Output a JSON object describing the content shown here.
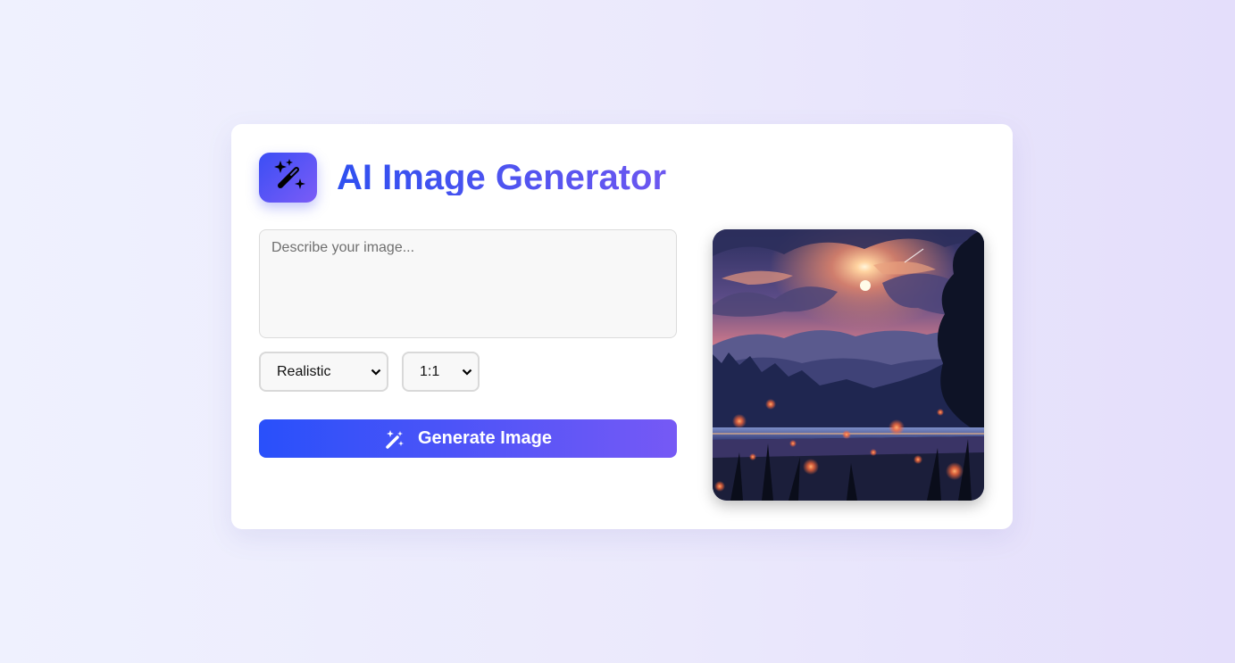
{
  "app": {
    "title": "AI Image Generator",
    "logo_icon": "magic-wand-icon"
  },
  "form": {
    "prompt_placeholder": "Describe your image...",
    "prompt_value": "",
    "style_select": {
      "selected": "Realistic"
    },
    "ratio_select": {
      "selected": "1:1"
    },
    "generate_button": {
      "label": "Generate Image",
      "icon": "magic-wand-icon"
    }
  },
  "preview": {
    "image": "landscape-sunset-fireflies"
  },
  "colors": {
    "accent_start": "#2950fa",
    "accent_end": "#7659f5"
  }
}
